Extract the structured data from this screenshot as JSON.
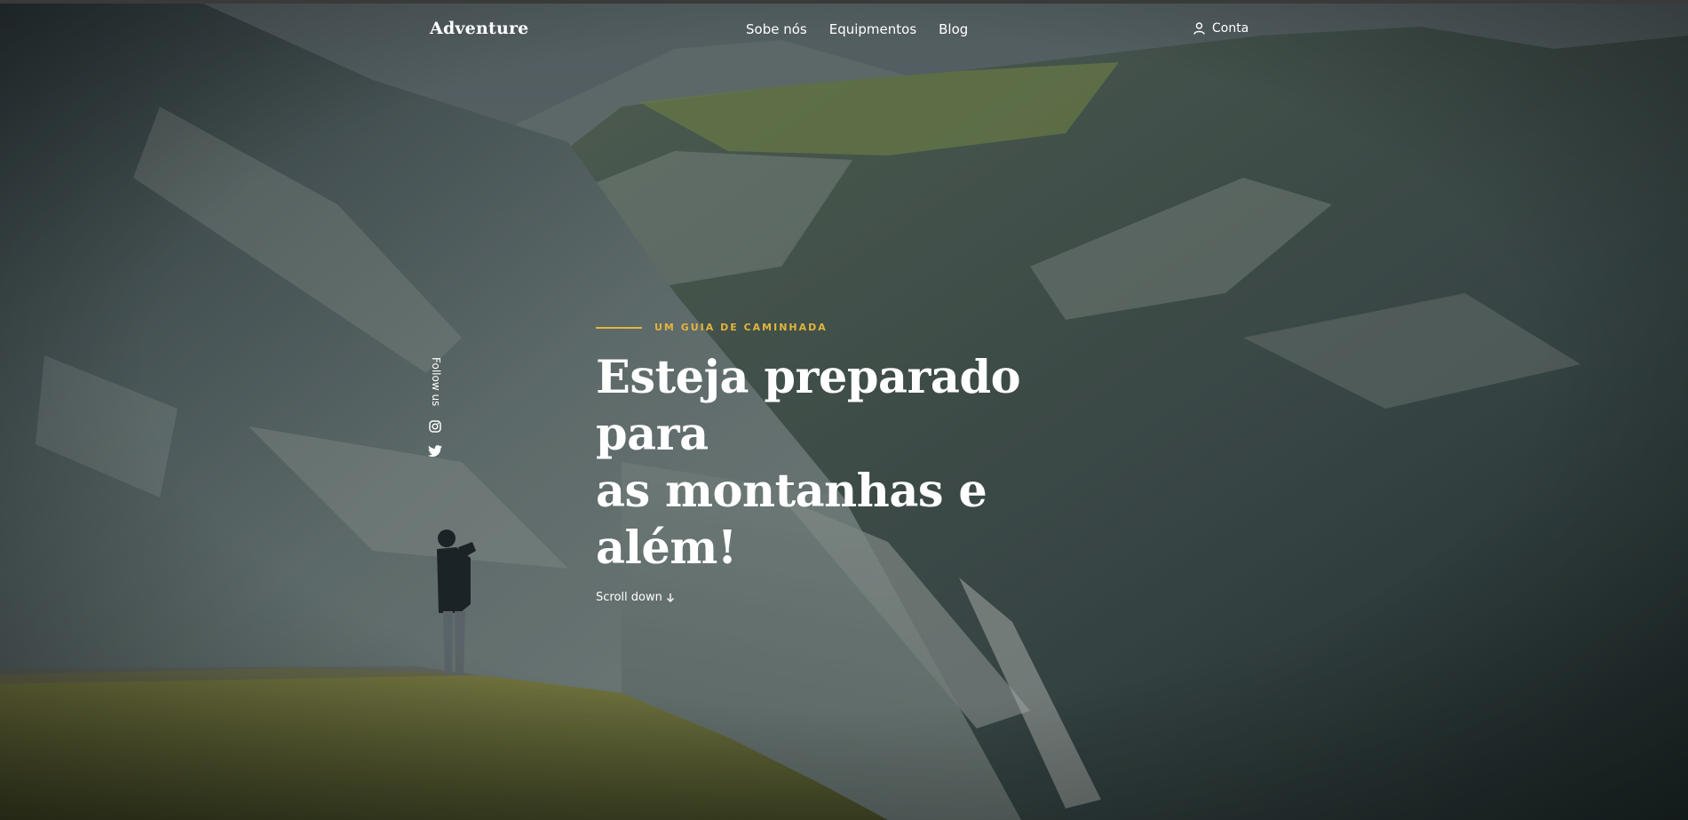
{
  "header": {
    "logo": "Adventure",
    "nav": [
      {
        "label": "Sobe nós"
      },
      {
        "label": "Equipmentos"
      },
      {
        "label": "Blog"
      }
    ],
    "account_label": "Conta"
  },
  "social": {
    "follow_label": "Follow us",
    "icons": [
      "instagram-icon",
      "twitter-icon"
    ]
  },
  "hero": {
    "eyebrow": "UM GUIA DE CAMINHADA",
    "headline_line1": "Esteja preparado para",
    "headline_line2": "as montanhas e além!",
    "scroll_label": "Scroll down"
  },
  "colors": {
    "accent": "#e2b53c",
    "text": "#ffffff"
  }
}
